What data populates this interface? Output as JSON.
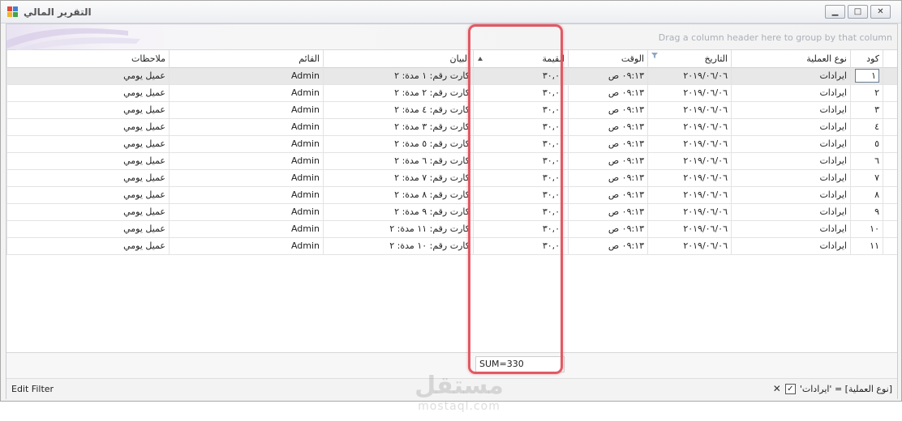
{
  "window": {
    "title": "التقرير المالي",
    "min_icon": "minimize-icon",
    "max_icon": "maximize-icon",
    "close_icon": "close-icon",
    "min_glyph": "▁",
    "max_glyph": "□",
    "close_glyph": "✕"
  },
  "group_panel": {
    "hint": "Drag a column header here to group by that column"
  },
  "columns": {
    "code": "كود",
    "type": "نوع العملية",
    "date": "التاريخ",
    "time": "الوقت",
    "value": "القيمة",
    "description": "البيان",
    "user": "القائم",
    "notes": "ملاحظات"
  },
  "rows": [
    {
      "code": "١",
      "type": "ايرادات",
      "date": "٢٠١٩/٠٦/٠٦",
      "time": "٠٩:١٣ ص",
      "value": "٣٠,٠٠",
      "description": "كارت رقم: ١ مدة: ٢",
      "user": "Admin",
      "notes": "عميل يومي"
    },
    {
      "code": "٢",
      "type": "ايرادات",
      "date": "٢٠١٩/٠٦/٠٦",
      "time": "٠٩:١٣ ص",
      "value": "٣٠,٠٠",
      "description": "كارت رقم: ٢ مدة: ٢",
      "user": "Admin",
      "notes": "عميل يومي"
    },
    {
      "code": "٣",
      "type": "ايرادات",
      "date": "٢٠١٩/٠٦/٠٦",
      "time": "٠٩:١٣ ص",
      "value": "٣٠,٠٠",
      "description": "كارت رقم: ٤ مدة: ٢",
      "user": "Admin",
      "notes": "عميل يومي"
    },
    {
      "code": "٤",
      "type": "ايرادات",
      "date": "٢٠١٩/٠٦/٠٦",
      "time": "٠٩:١٣ ص",
      "value": "٣٠,٠٠",
      "description": "كارت رقم: ٣ مدة: ٢",
      "user": "Admin",
      "notes": "عميل يومي"
    },
    {
      "code": "٥",
      "type": "ايرادات",
      "date": "٢٠١٩/٠٦/٠٦",
      "time": "٠٩:١٣ ص",
      "value": "٣٠,٠٠",
      "description": "كارت رقم: ٥ مدة: ٢",
      "user": "Admin",
      "notes": "عميل يومي"
    },
    {
      "code": "٦",
      "type": "ايرادات",
      "date": "٢٠١٩/٠٦/٠٦",
      "time": "٠٩:١٣ ص",
      "value": "٣٠,٠٠",
      "description": "كارت رقم: ٦ مدة: ٢",
      "user": "Admin",
      "notes": "عميل يومي"
    },
    {
      "code": "٧",
      "type": "ايرادات",
      "date": "٢٠١٩/٠٦/٠٦",
      "time": "٠٩:١٣ ص",
      "value": "٣٠,٠٠",
      "description": "كارت رقم: ٧ مدة: ٢",
      "user": "Admin",
      "notes": "عميل يومي"
    },
    {
      "code": "٨",
      "type": "ايرادات",
      "date": "٢٠١٩/٠٦/٠٦",
      "time": "٠٩:١٣ ص",
      "value": "٣٠,٠٠",
      "description": "كارت رقم: ٨ مدة: ٢",
      "user": "Admin",
      "notes": "عميل يومي"
    },
    {
      "code": "٩",
      "type": "ايرادات",
      "date": "٢٠١٩/٠٦/٠٦",
      "time": "٠٩:١٣ ص",
      "value": "٣٠,٠٠",
      "description": "كارت رقم: ٩ مدة: ٢",
      "user": "Admin",
      "notes": "عميل يومي"
    },
    {
      "code": "١٠",
      "type": "ايرادات",
      "date": "٢٠١٩/٠٦/٠٦",
      "time": "٠٩:١٣ ص",
      "value": "٣٠,٠٠",
      "description": "كارت رقم: ١١ مدة: ٢",
      "user": "Admin",
      "notes": "عميل يومي"
    },
    {
      "code": "١١",
      "type": "ايرادات",
      "date": "٢٠١٩/٠٦/٠٦",
      "time": "٠٩:١٣ ص",
      "value": "٣٠,٠٠",
      "description": "كارت رقم: ١٠ مدة: ٢",
      "user": "Admin",
      "notes": "عميل يومي"
    }
  ],
  "selected_row": 0,
  "summary": {
    "value_sum": "SUM=330"
  },
  "filter": {
    "edit_label": "Edit Filter",
    "expression": "[نوع العملية] = 'ايرادات'",
    "enabled": true,
    "check_glyph": "✓",
    "close_glyph": "✕"
  },
  "watermark": {
    "arabic": "مستقل",
    "latin": "mostaql.com"
  },
  "colors": {
    "highlight": "#e05a64",
    "selected_row": "#e8e8e8"
  }
}
